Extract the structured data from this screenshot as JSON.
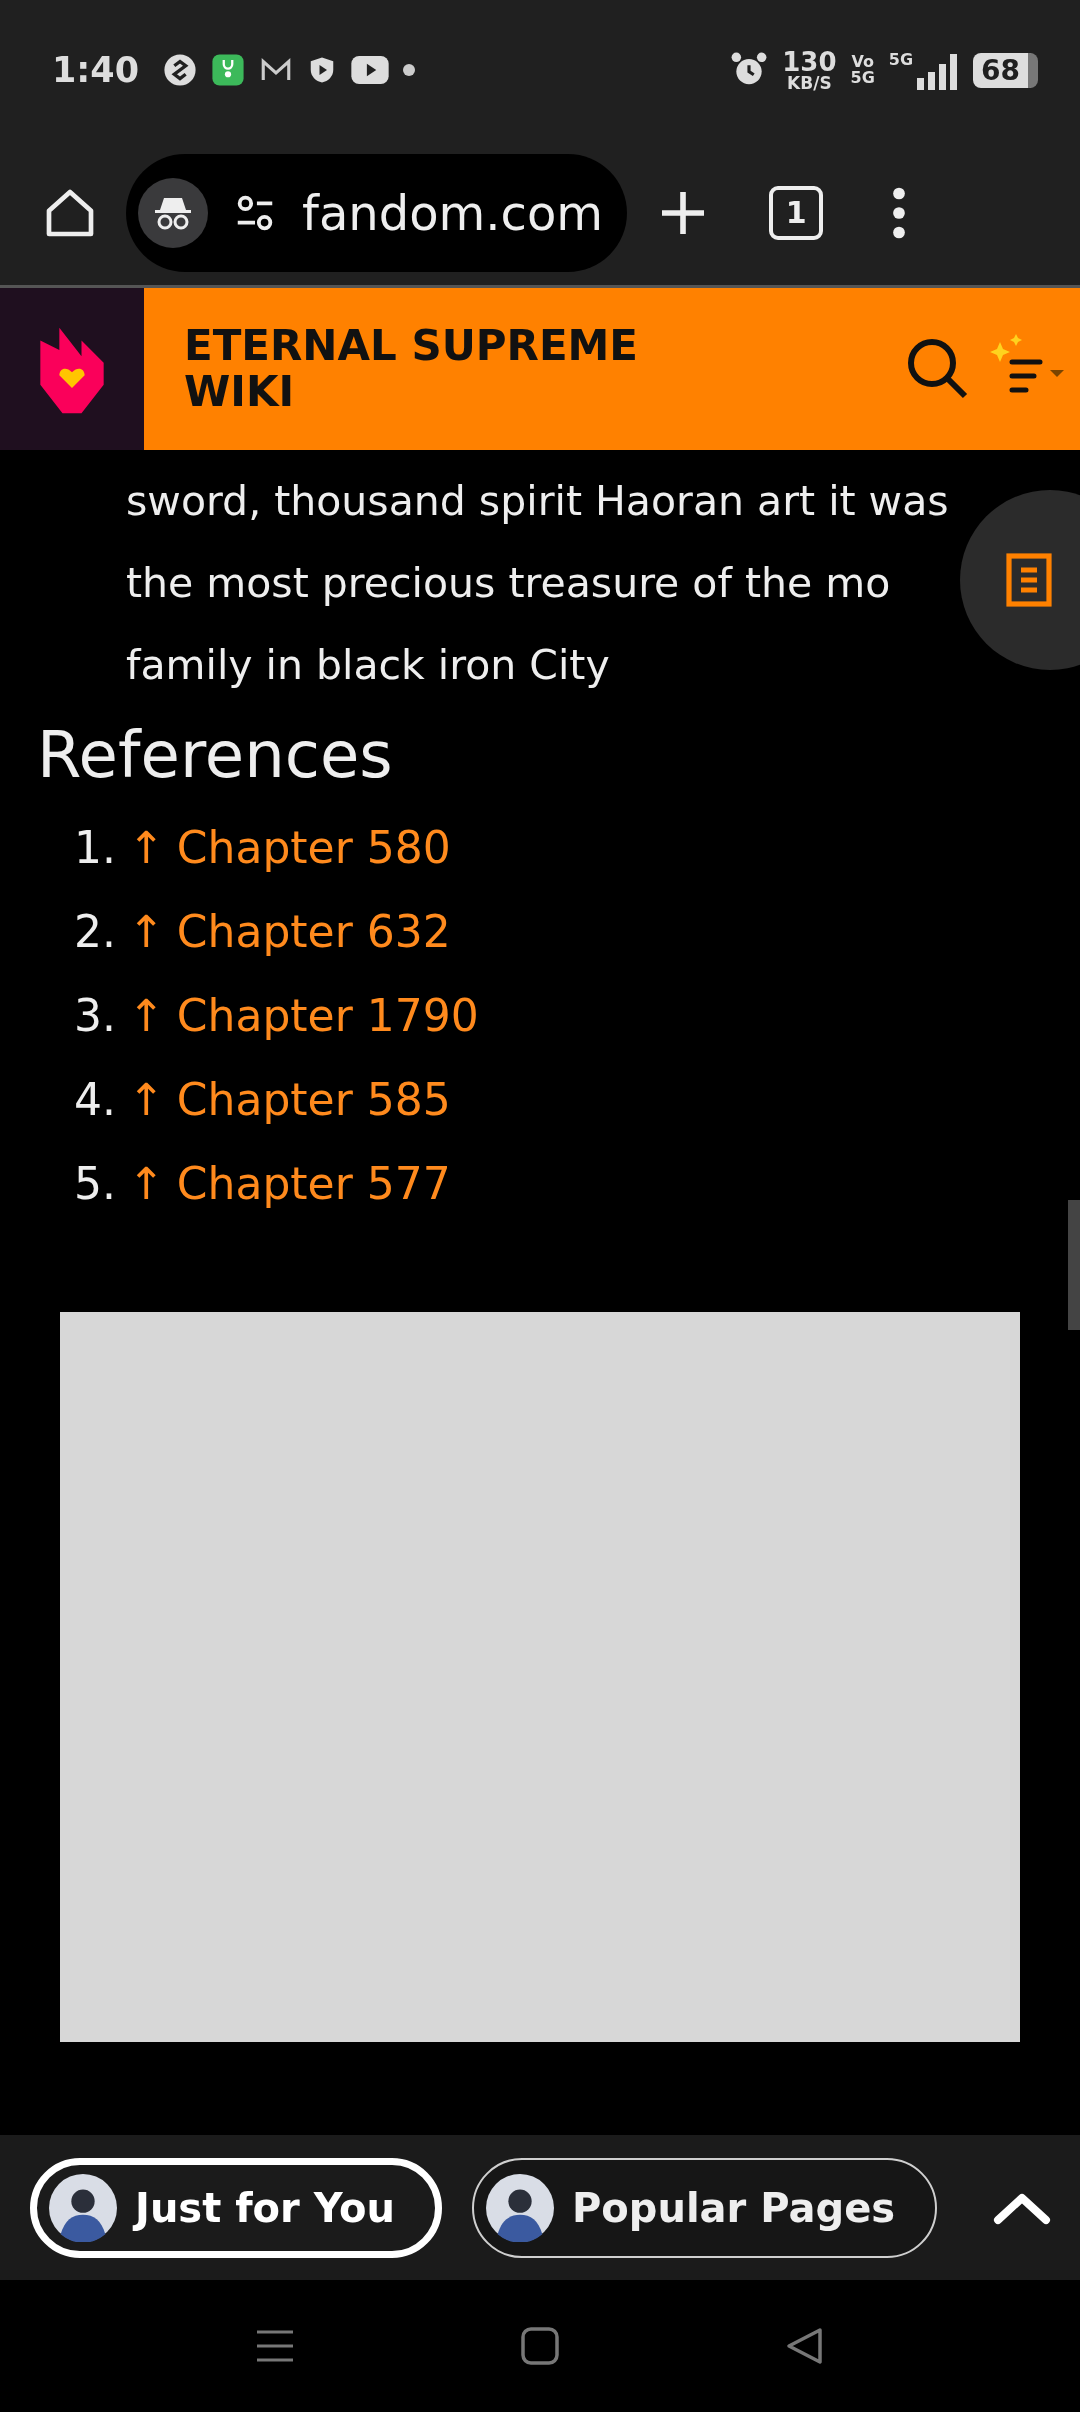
{
  "status_bar": {
    "time": "1:40",
    "speed_value": "130",
    "speed_unit": "KB/S",
    "volte_top": "Vo",
    "volte_bottom": "5G",
    "network": "5G",
    "battery": "68"
  },
  "browser": {
    "url": "fandom.com",
    "tab_count": "1"
  },
  "wiki_header": {
    "title": "ETERNAL SUPREME WIKI"
  },
  "article": {
    "paragraph_lines": [
      "sword, thousand spirit Haoran art it was",
      "the most precious treasure of the mo",
      "family in black iron City"
    ],
    "references_heading": "References",
    "references": [
      {
        "number": "1.",
        "arrow": "↑",
        "link": "Chapter 580"
      },
      {
        "number": "2.",
        "arrow": "↑",
        "link": "Chapter 632"
      },
      {
        "number": "3.",
        "arrow": "↑",
        "link": "Chapter 1790"
      },
      {
        "number": "4.",
        "arrow": "↑",
        "link": "Chapter 585"
      },
      {
        "number": "5.",
        "arrow": "↑",
        "link": "Chapter 577"
      }
    ]
  },
  "bottom_bar": {
    "pills": [
      {
        "label": "Just for You",
        "selected": true
      },
      {
        "label": "Popular Pages",
        "selected": false
      }
    ]
  }
}
